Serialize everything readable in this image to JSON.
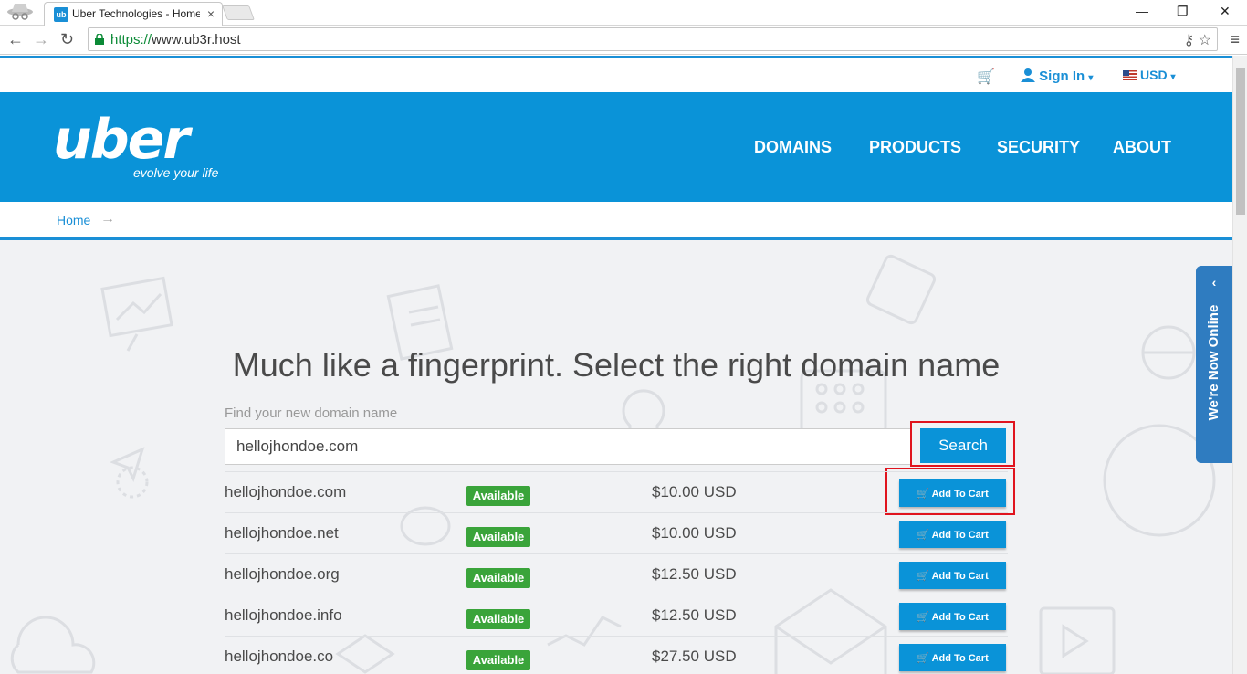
{
  "browser": {
    "tab_title": "Uber Technologies - Home",
    "favicon_text": "ub",
    "url_scheme": "https://",
    "url_rest": "www.ub3r.host"
  },
  "utility": {
    "sign_in": "Sign In",
    "currency": "USD"
  },
  "header": {
    "logo": "uber",
    "tagline": "evolve your life",
    "nav": [
      "DOMAINS",
      "PRODUCTS",
      "SECURITY",
      "ABOUT"
    ]
  },
  "breadcrumb": {
    "home": "Home"
  },
  "hero": {
    "title": "Much like a fingerprint. Select the right domain name",
    "field_label": "Find your new domain name",
    "search_value": "hellojhondoe.com",
    "search_button": "Search"
  },
  "results": [
    {
      "domain": "hellojhondoe.com",
      "status": "Available",
      "price": "$10.00 USD",
      "action": "Add To Cart"
    },
    {
      "domain": "hellojhondoe.net",
      "status": "Available",
      "price": "$10.00 USD",
      "action": "Add To Cart"
    },
    {
      "domain": "hellojhondoe.org",
      "status": "Available",
      "price": "$12.50 USD",
      "action": "Add To Cart"
    },
    {
      "domain": "hellojhondoe.info",
      "status": "Available",
      "price": "$12.50 USD",
      "action": "Add To Cart"
    },
    {
      "domain": "hellojhondoe.co",
      "status": "Available",
      "price": "$27.50 USD",
      "action": "Add To Cart"
    }
  ],
  "chat": {
    "label": "We're Now Online"
  },
  "colors": {
    "brand": "#0a93d8",
    "available": "#3aa43a",
    "highlight": "#e0141e"
  }
}
